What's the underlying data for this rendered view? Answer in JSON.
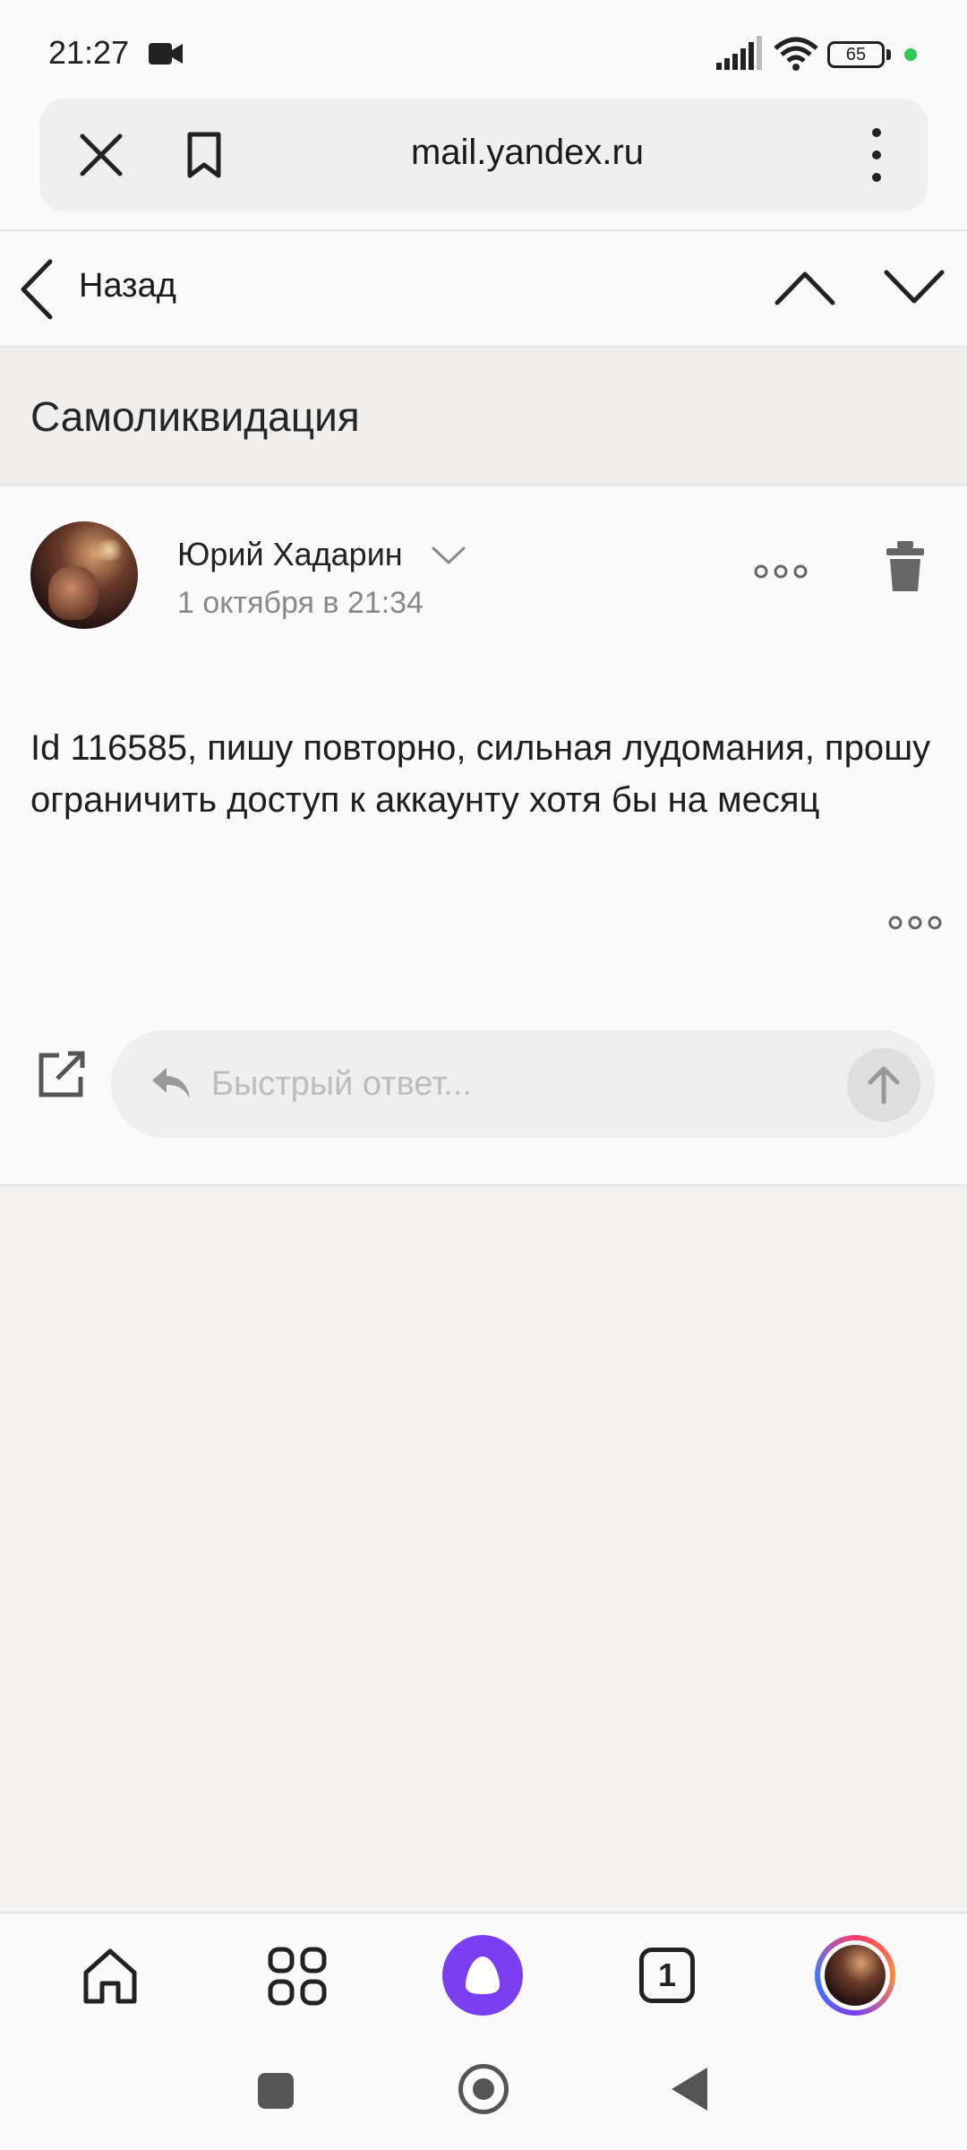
{
  "status_bar": {
    "time": "21:27",
    "battery": "65",
    "icons": [
      "video-camera-icon",
      "signal-icon",
      "wifi-icon",
      "battery-icon",
      "privacy-dot"
    ]
  },
  "browser": {
    "url": "mail.yandex.ru",
    "icons": [
      "close-icon",
      "bookmark-icon",
      "more-vertical-icon"
    ]
  },
  "mail_nav": {
    "back_label": "Назад",
    "icons": [
      "chevron-left-icon",
      "chevron-up-icon",
      "chevron-down-icon"
    ]
  },
  "email": {
    "subject": "Самоликвидация",
    "sender": "Юрий Хадарин",
    "date": "1 октября в 21:34",
    "body": "Id 116585, пишу повторно, сильная лудомания, прошу ограничить доступ к аккаунту хотя бы на месяц"
  },
  "quick_reply": {
    "placeholder": "Быстрый ответ..."
  },
  "bottom_nav": {
    "tab_count": "1",
    "items": [
      "home-icon",
      "apps-grid-icon",
      "alice-icon",
      "tabs-icon",
      "profile-avatar"
    ]
  },
  "colors": {
    "alice": "#7b3ff2",
    "status_dot": "#34c759"
  }
}
